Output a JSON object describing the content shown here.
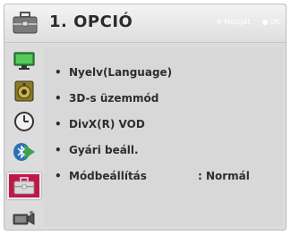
{
  "header": {
    "title": "1. OPCIÓ",
    "hint_move": "Mozgat.",
    "hint_ok": "OK"
  },
  "sidebar": {
    "items": [
      {
        "name": "picture",
        "icon": "monitor-icon"
      },
      {
        "name": "audio",
        "icon": "speaker-icon"
      },
      {
        "name": "time",
        "icon": "clock-icon"
      },
      {
        "name": "network",
        "icon": "bluetooth-icon"
      },
      {
        "name": "option",
        "icon": "briefcase-icon",
        "active": true
      },
      {
        "name": "input",
        "icon": "camera-icon"
      }
    ]
  },
  "menu": {
    "items": [
      {
        "label": "Nyelv(Language)"
      },
      {
        "label": "3D-s üzemmód"
      },
      {
        "label": "DivX(R) VOD"
      },
      {
        "label": "Gyári beáll."
      },
      {
        "label": "Módbeállítás",
        "value": ": Normál"
      }
    ]
  },
  "colors": {
    "accent": "#c0174a",
    "background": "#d8d8d8",
    "header": "#e8e8e8"
  }
}
